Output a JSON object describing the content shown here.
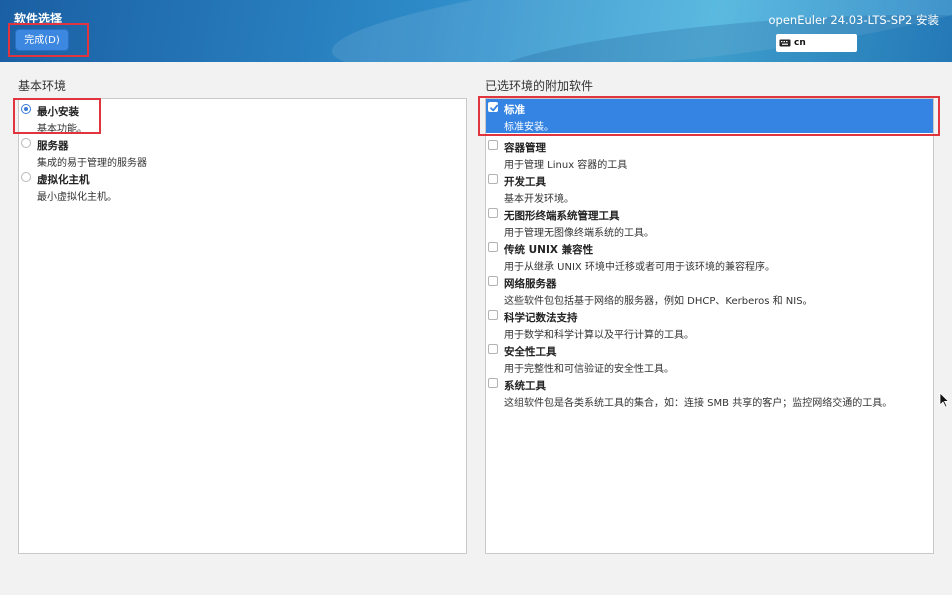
{
  "header": {
    "page_title": "软件选择",
    "done_label": "完成(D)",
    "product_title": "openEuler 24.03-LTS-SP2 安装",
    "keyboard_layout": "cn"
  },
  "environments": {
    "label": "基本环境",
    "items": [
      {
        "title": "最小安装",
        "desc": "基本功能。",
        "selected": true
      },
      {
        "title": "服务器",
        "desc": "集成的易于管理的服务器",
        "selected": false
      },
      {
        "title": "虚拟化主机",
        "desc": "最小虚拟化主机。",
        "selected": false
      }
    ]
  },
  "addons": {
    "label": "已选环境的附加软件",
    "items": [
      {
        "title": "标准",
        "desc": "标准安装。",
        "checked": true
      },
      {
        "title": "容器管理",
        "desc": "用于管理 Linux 容器的工具",
        "checked": false
      },
      {
        "title": "开发工具",
        "desc": "基本开发环境。",
        "checked": false
      },
      {
        "title": "无图形终端系统管理工具",
        "desc": "用于管理无图像终端系统的工具。",
        "checked": false
      },
      {
        "title": "传统 UNIX 兼容性",
        "desc": "用于从继承 UNIX 环境中迁移或者可用于该环境的兼容程序。",
        "checked": false
      },
      {
        "title": "网络服务器",
        "desc": "这些软件包包括基于网络的服务器，例如 DHCP、Kerberos 和 NIS。",
        "checked": false
      },
      {
        "title": "科学记数法支持",
        "desc": "用于数学和科学计算以及平行计算的工具。",
        "checked": false
      },
      {
        "title": "安全性工具",
        "desc": "用于完整性和可信验证的安全性工具。",
        "checked": false
      },
      {
        "title": "系统工具",
        "desc": "这组软件包是各类系统工具的集合，如：连接 SMB 共享的客户；监控网络交通的工具。",
        "checked": false
      }
    ]
  },
  "colors": {
    "accent": "#3584e4",
    "highlight_box": "#e0353f"
  }
}
